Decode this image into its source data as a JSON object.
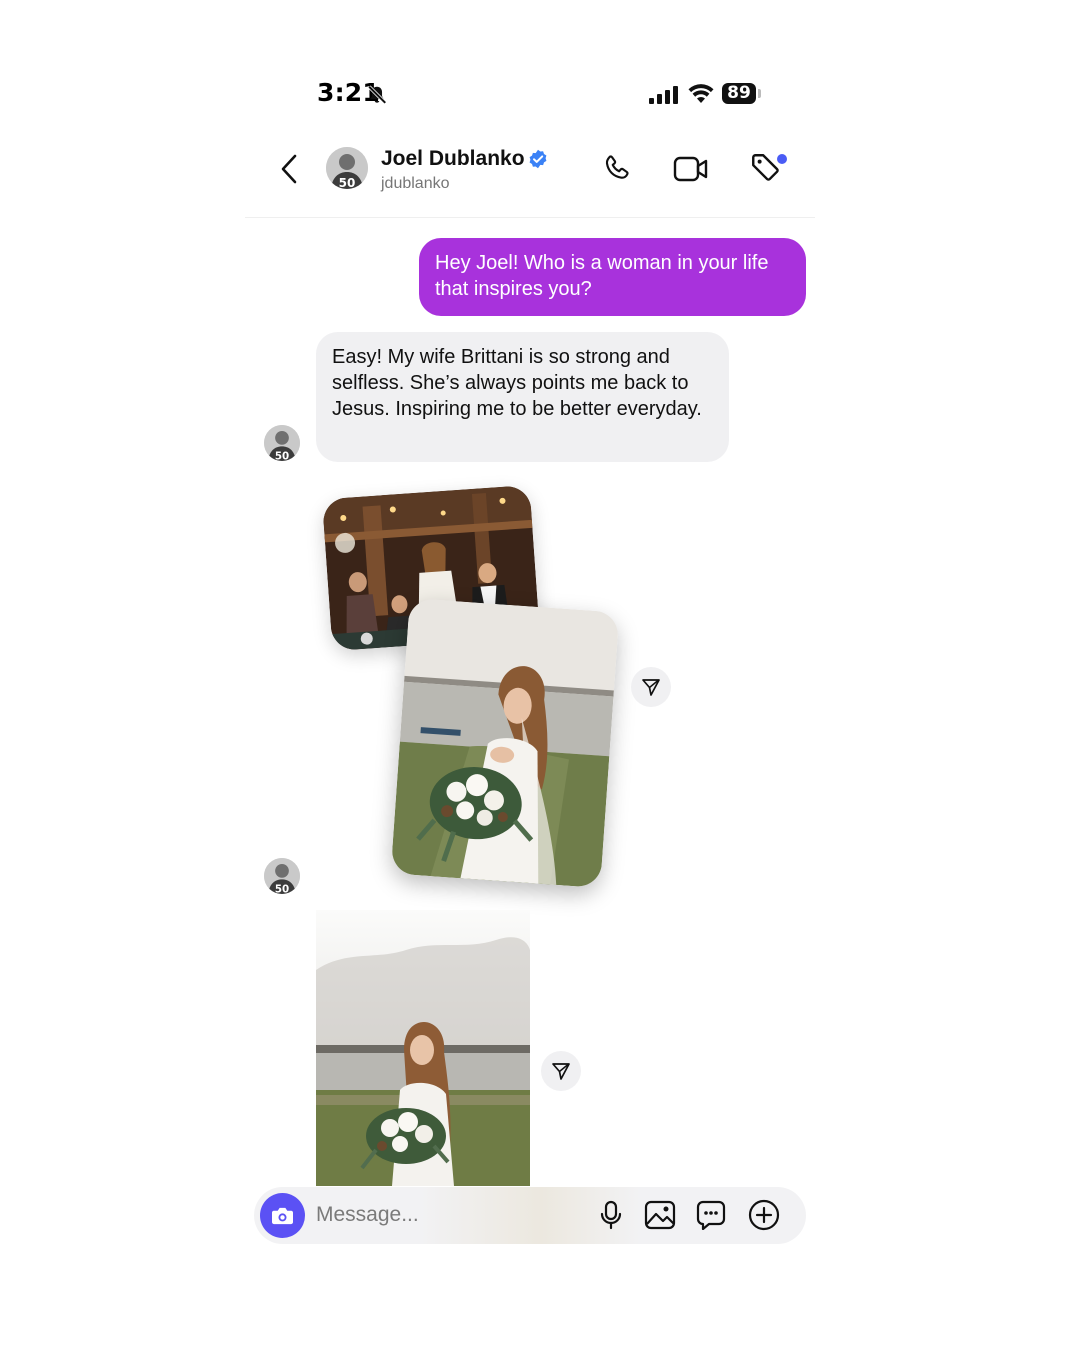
{
  "status_bar": {
    "time": "3:21",
    "battery": "89"
  },
  "header": {
    "name": "Joel Dublanko",
    "username": "jdublanko"
  },
  "messages": {
    "sent_1": "Hey Joel! Who is a woman in your life that inspires you?",
    "received_1": "Easy! My wife Brittani is so strong and selfless. She’s always points me back to Jesus. Inspiring me to be better everyday."
  },
  "composer": {
    "placeholder": "Message..."
  },
  "colors": {
    "sent_bubble": "#a832dc",
    "received_bubble": "#f0f0f2",
    "camera_button": "#5b51f4",
    "verified": "#3b82f6",
    "notification_dot": "#4a5cf5"
  }
}
